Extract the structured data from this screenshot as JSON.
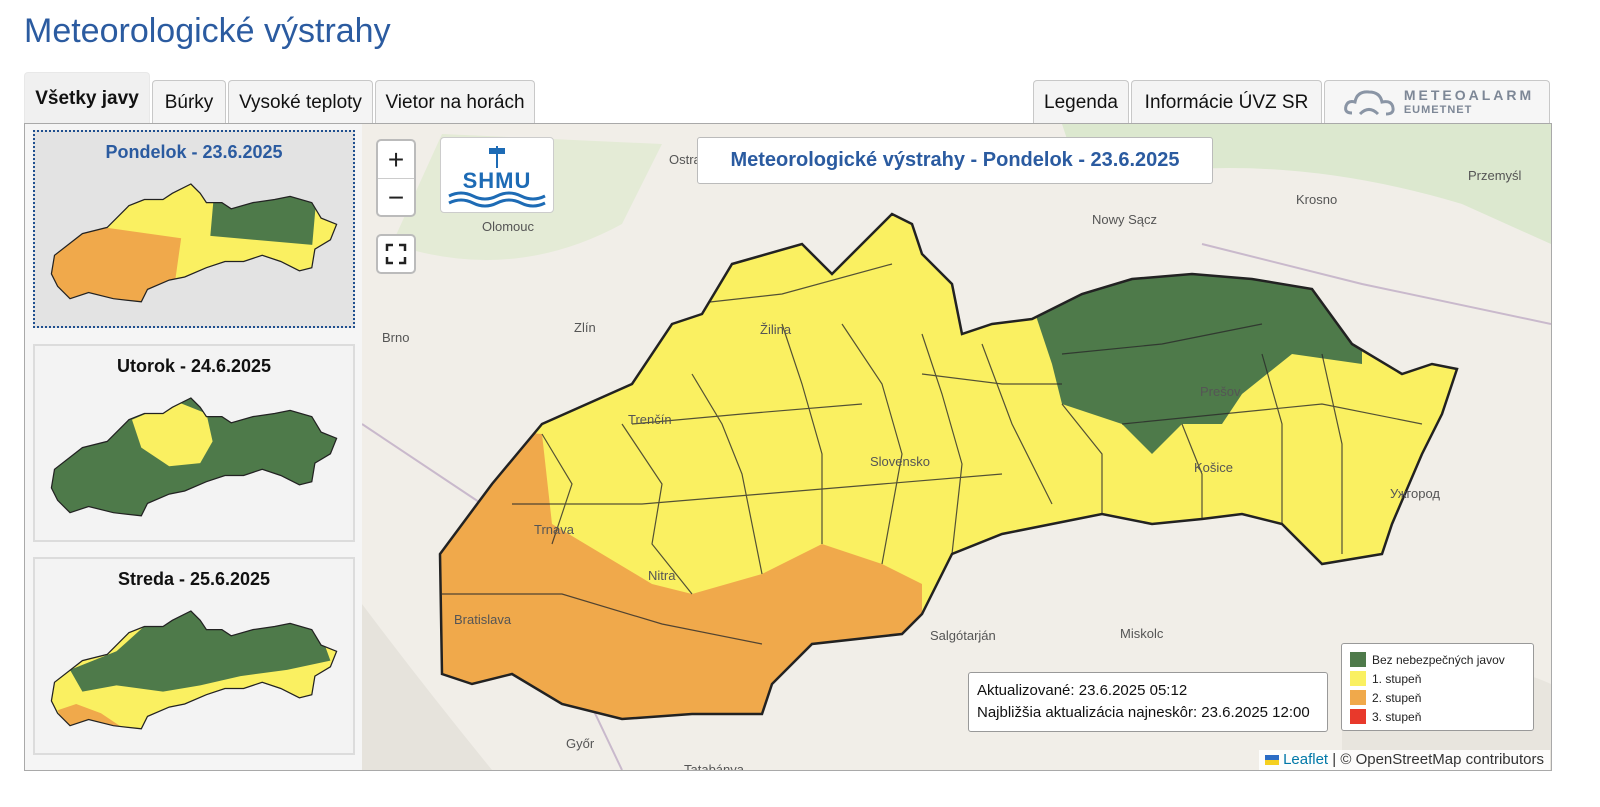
{
  "page": {
    "title": "Meteorologické výstrahy"
  },
  "tabs": {
    "left": [
      {
        "label": "Všetky javy",
        "active": true
      },
      {
        "label": "Búrky"
      },
      {
        "label": "Vysoké teploty"
      },
      {
        "label": "Vietor na horách"
      }
    ],
    "right": [
      {
        "label": "Legenda"
      },
      {
        "label": "Informácie ÚVZ SR"
      }
    ],
    "meteoalarm": {
      "title": "METEOALARM",
      "subtitle": "EUMETNET"
    }
  },
  "days": [
    {
      "label": "Pondelok - 23.6.2025",
      "selected": true
    },
    {
      "label": "Utorok - 24.6.2025"
    },
    {
      "label": "Streda - 25.6.2025"
    }
  ],
  "map": {
    "title": "Meteorologické výstrahy - Pondelok - 23.6.2025",
    "zoom_in": "+",
    "zoom_out": "−",
    "logo_text": "SHMU",
    "update": {
      "updated": "Aktualizované: 23.6.2025 05:12",
      "next": "Najbližšia aktualizácia najneskôr: 23.6.2025 12:00"
    },
    "legend": [
      {
        "label": "Bez nebezpečných javov",
        "color": "#4e7a4a"
      },
      {
        "label": "1. stupeň",
        "color": "#faf061"
      },
      {
        "label": "2. stupeň",
        "color": "#f0a94b"
      },
      {
        "label": "3. stupeň",
        "color": "#e8392b"
      }
    ],
    "attribution": {
      "leaflet": "Leaflet",
      "osm": "| © OpenStreetMap contributors"
    },
    "cities": [
      "Ostrava",
      "Olomouc",
      "Brno",
      "Zlín",
      "Žilina",
      "Trenčín",
      "Trnava",
      "Nitra",
      "Bratislava",
      "Slovensko",
      "Prešov",
      "Košice",
      "Nowy Sącz",
      "Krosno",
      "Przemyśl",
      "Ужгород",
      "Salgótarján",
      "Miskolc",
      "Győr",
      "Tatabánya"
    ]
  },
  "colors": {
    "accent": "#2b5ba0",
    "green": "#4e7a4a",
    "yellow": "#faf061",
    "orange": "#f0a94b",
    "red": "#e8392b"
  }
}
